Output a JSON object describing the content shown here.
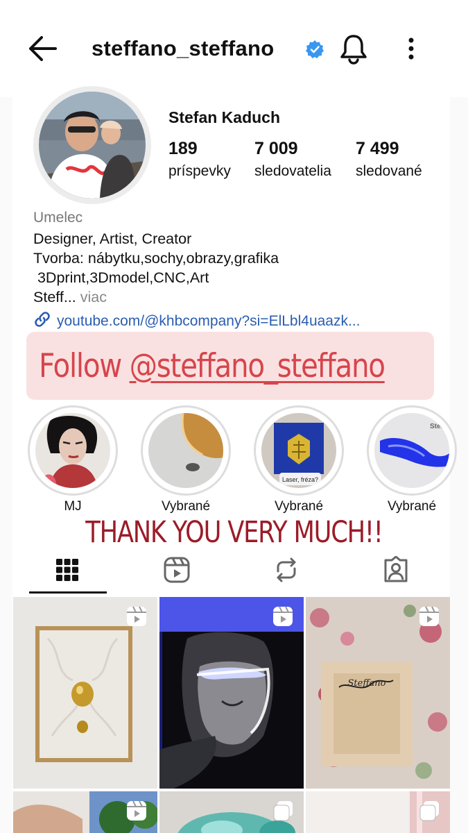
{
  "header": {
    "username": "steffano_steffano"
  },
  "profile": {
    "full_name": "Stefan Kaduch",
    "stats": [
      {
        "value": "189",
        "label": "príspevky"
      },
      {
        "value": "7 009",
        "label": "sledovatelia"
      },
      {
        "value": "7 499",
        "label": "sledované"
      }
    ],
    "category": "Umelec",
    "bio_lines": [
      "Designer, Artist, Creator",
      "Tvorba: nábytku,sochy,obrazy,grafika",
      " 3Dprint,3Dmodel,CNC,Art"
    ],
    "bio_truncated": "Steff...",
    "bio_more": " viac",
    "link": "youtube.com/@khbcompany?si=ElLbl4uaazk..."
  },
  "banner": {
    "prefix": "Follow ",
    "handle": "@steffano_steffano",
    "color": "#d6454c",
    "background": "#fae1e1"
  },
  "highlights": [
    {
      "label": "MJ"
    },
    {
      "label": "Vybrané"
    },
    {
      "label": "Vybrané",
      "overlay_text": "Laser, fréza?"
    },
    {
      "label": "Vybrané",
      "overlay_text": "Steffa"
    }
  ],
  "thanks_text": "THANK YOU VERY MUCH!!",
  "tabs": [
    {
      "icon": "grid-icon",
      "active": true
    },
    {
      "icon": "reels-icon",
      "active": false
    },
    {
      "icon": "reposts-icon",
      "active": false
    },
    {
      "icon": "tagged-icon",
      "active": false
    }
  ],
  "grid": [
    {
      "icon": "reel-icon"
    },
    {
      "icon": "reel-icon"
    },
    {
      "icon": "reel-icon",
      "overlay_text": "Steffano"
    },
    {
      "icon": "reel-icon"
    },
    {
      "icon": "carousel-icon"
    },
    {
      "icon": "carousel-icon"
    }
  ],
  "colors": {
    "verified": "#3897f0",
    "link": "#2a5db0",
    "thanks": "#9b1c28"
  }
}
